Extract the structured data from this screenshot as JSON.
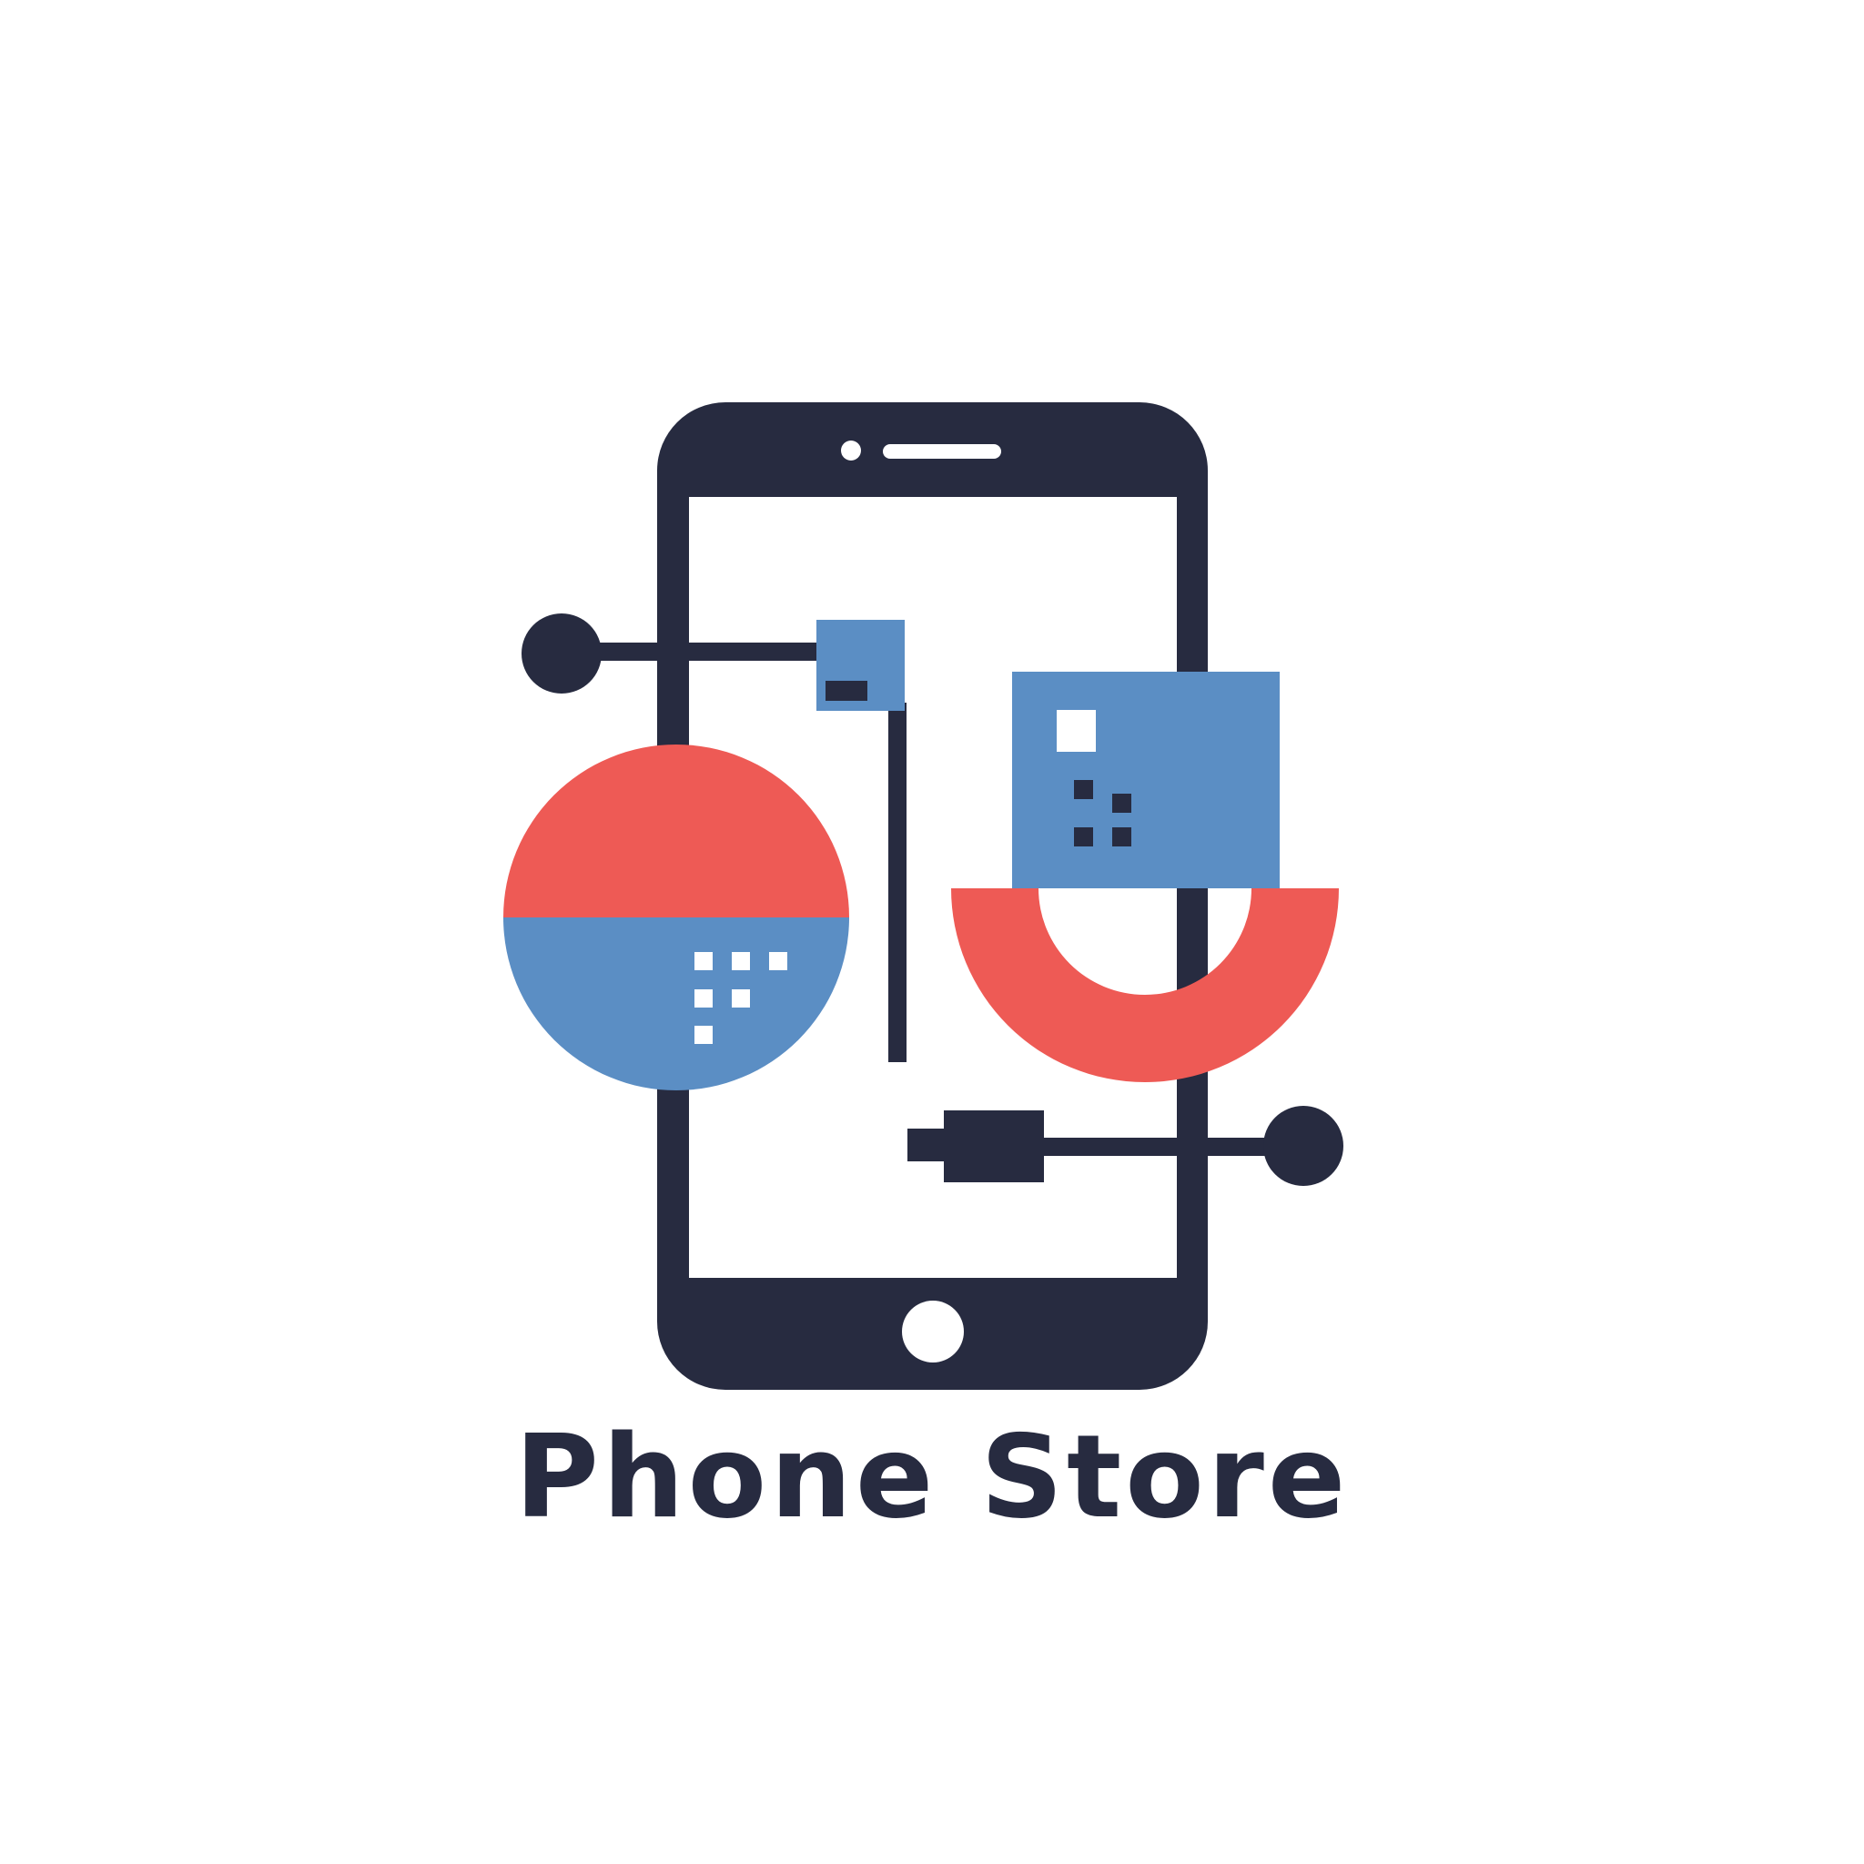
{
  "brand": {
    "name": "Phone Store"
  },
  "colors": {
    "background": "#ffffff",
    "ink": "#272b40",
    "accent_red": "#ee5a55",
    "accent_blue": "#5b8ec4"
  },
  "icons": {
    "logo": "smartphone-with-circuit-shapes-icon"
  }
}
